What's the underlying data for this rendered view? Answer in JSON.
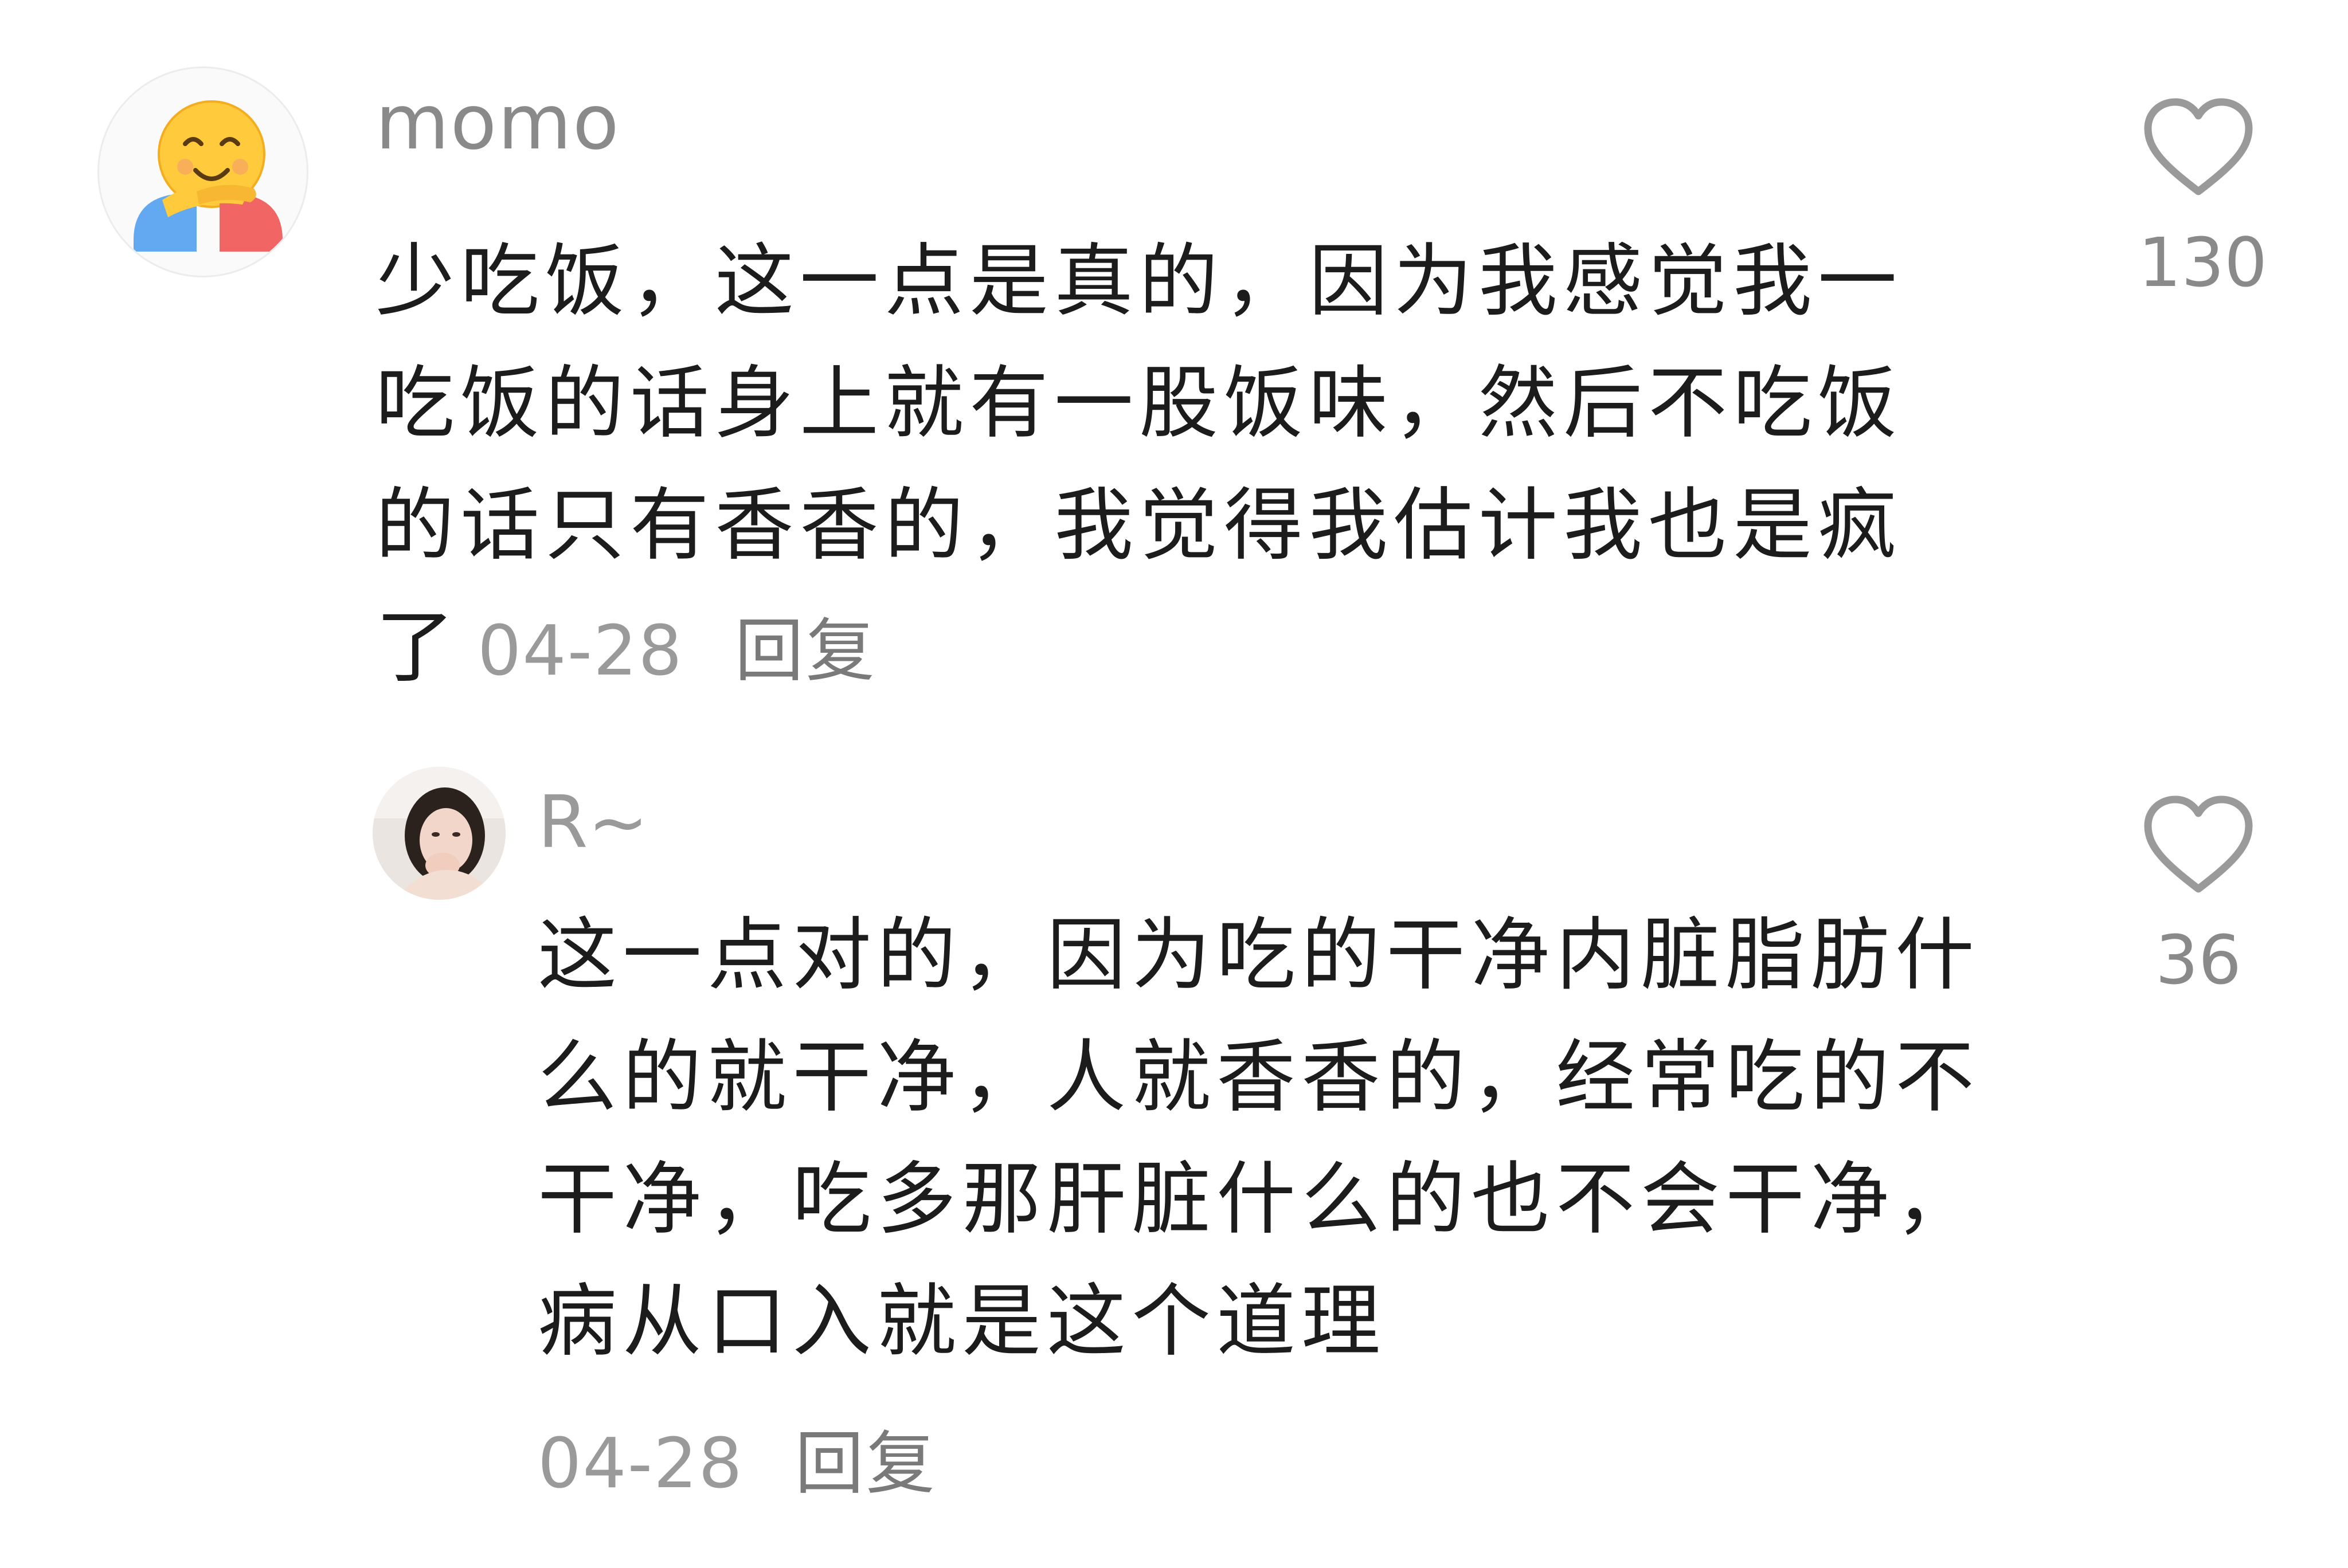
{
  "comments": [
    {
      "username": "momo",
      "avatar": "hugging-face-emoji",
      "text": "少吃饭，这一点是真的，因为我感觉我一吃饭的话身上就有一股饭味，然后不吃饭的话只有香香的，我觉得我估计我也是疯了",
      "date": "04-28",
      "reply_label": "回复",
      "likes": "130",
      "like_icon": "heart-outline-icon"
    },
    {
      "username": "R~",
      "avatar": "user-photo",
      "text": "这一点对的，因为吃的干净内脏脂肪什么的就干净，人就香香的，经常吃的不干净，吃多那肝脏什么的也不会干净，病从口入就是这个道理",
      "date": "04-28",
      "reply_label": "回复",
      "likes": "36",
      "like_icon": "heart-outline-icon"
    }
  ]
}
